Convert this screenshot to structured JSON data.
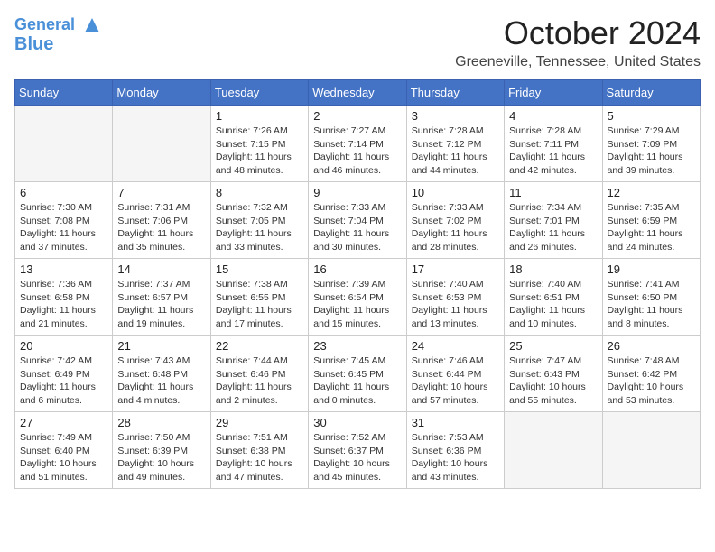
{
  "header": {
    "logo_line1": "General",
    "logo_line2": "Blue",
    "month_title": "October 2024",
    "location": "Greeneville, Tennessee, United States"
  },
  "weekdays": [
    "Sunday",
    "Monday",
    "Tuesday",
    "Wednesday",
    "Thursday",
    "Friday",
    "Saturday"
  ],
  "weeks": [
    [
      {
        "day": "",
        "info": ""
      },
      {
        "day": "",
        "info": ""
      },
      {
        "day": "1",
        "info": "Sunrise: 7:26 AM\nSunset: 7:15 PM\nDaylight: 11 hours and 48 minutes."
      },
      {
        "day": "2",
        "info": "Sunrise: 7:27 AM\nSunset: 7:14 PM\nDaylight: 11 hours and 46 minutes."
      },
      {
        "day": "3",
        "info": "Sunrise: 7:28 AM\nSunset: 7:12 PM\nDaylight: 11 hours and 44 minutes."
      },
      {
        "day": "4",
        "info": "Sunrise: 7:28 AM\nSunset: 7:11 PM\nDaylight: 11 hours and 42 minutes."
      },
      {
        "day": "5",
        "info": "Sunrise: 7:29 AM\nSunset: 7:09 PM\nDaylight: 11 hours and 39 minutes."
      }
    ],
    [
      {
        "day": "6",
        "info": "Sunrise: 7:30 AM\nSunset: 7:08 PM\nDaylight: 11 hours and 37 minutes."
      },
      {
        "day": "7",
        "info": "Sunrise: 7:31 AM\nSunset: 7:06 PM\nDaylight: 11 hours and 35 minutes."
      },
      {
        "day": "8",
        "info": "Sunrise: 7:32 AM\nSunset: 7:05 PM\nDaylight: 11 hours and 33 minutes."
      },
      {
        "day": "9",
        "info": "Sunrise: 7:33 AM\nSunset: 7:04 PM\nDaylight: 11 hours and 30 minutes."
      },
      {
        "day": "10",
        "info": "Sunrise: 7:33 AM\nSunset: 7:02 PM\nDaylight: 11 hours and 28 minutes."
      },
      {
        "day": "11",
        "info": "Sunrise: 7:34 AM\nSunset: 7:01 PM\nDaylight: 11 hours and 26 minutes."
      },
      {
        "day": "12",
        "info": "Sunrise: 7:35 AM\nSunset: 6:59 PM\nDaylight: 11 hours and 24 minutes."
      }
    ],
    [
      {
        "day": "13",
        "info": "Sunrise: 7:36 AM\nSunset: 6:58 PM\nDaylight: 11 hours and 21 minutes."
      },
      {
        "day": "14",
        "info": "Sunrise: 7:37 AM\nSunset: 6:57 PM\nDaylight: 11 hours and 19 minutes."
      },
      {
        "day": "15",
        "info": "Sunrise: 7:38 AM\nSunset: 6:55 PM\nDaylight: 11 hours and 17 minutes."
      },
      {
        "day": "16",
        "info": "Sunrise: 7:39 AM\nSunset: 6:54 PM\nDaylight: 11 hours and 15 minutes."
      },
      {
        "day": "17",
        "info": "Sunrise: 7:40 AM\nSunset: 6:53 PM\nDaylight: 11 hours and 13 minutes."
      },
      {
        "day": "18",
        "info": "Sunrise: 7:40 AM\nSunset: 6:51 PM\nDaylight: 11 hours and 10 minutes."
      },
      {
        "day": "19",
        "info": "Sunrise: 7:41 AM\nSunset: 6:50 PM\nDaylight: 11 hours and 8 minutes."
      }
    ],
    [
      {
        "day": "20",
        "info": "Sunrise: 7:42 AM\nSunset: 6:49 PM\nDaylight: 11 hours and 6 minutes."
      },
      {
        "day": "21",
        "info": "Sunrise: 7:43 AM\nSunset: 6:48 PM\nDaylight: 11 hours and 4 minutes."
      },
      {
        "day": "22",
        "info": "Sunrise: 7:44 AM\nSunset: 6:46 PM\nDaylight: 11 hours and 2 minutes."
      },
      {
        "day": "23",
        "info": "Sunrise: 7:45 AM\nSunset: 6:45 PM\nDaylight: 11 hours and 0 minutes."
      },
      {
        "day": "24",
        "info": "Sunrise: 7:46 AM\nSunset: 6:44 PM\nDaylight: 10 hours and 57 minutes."
      },
      {
        "day": "25",
        "info": "Sunrise: 7:47 AM\nSunset: 6:43 PM\nDaylight: 10 hours and 55 minutes."
      },
      {
        "day": "26",
        "info": "Sunrise: 7:48 AM\nSunset: 6:42 PM\nDaylight: 10 hours and 53 minutes."
      }
    ],
    [
      {
        "day": "27",
        "info": "Sunrise: 7:49 AM\nSunset: 6:40 PM\nDaylight: 10 hours and 51 minutes."
      },
      {
        "day": "28",
        "info": "Sunrise: 7:50 AM\nSunset: 6:39 PM\nDaylight: 10 hours and 49 minutes."
      },
      {
        "day": "29",
        "info": "Sunrise: 7:51 AM\nSunset: 6:38 PM\nDaylight: 10 hours and 47 minutes."
      },
      {
        "day": "30",
        "info": "Sunrise: 7:52 AM\nSunset: 6:37 PM\nDaylight: 10 hours and 45 minutes."
      },
      {
        "day": "31",
        "info": "Sunrise: 7:53 AM\nSunset: 6:36 PM\nDaylight: 10 hours and 43 minutes."
      },
      {
        "day": "",
        "info": ""
      },
      {
        "day": "",
        "info": ""
      }
    ]
  ]
}
